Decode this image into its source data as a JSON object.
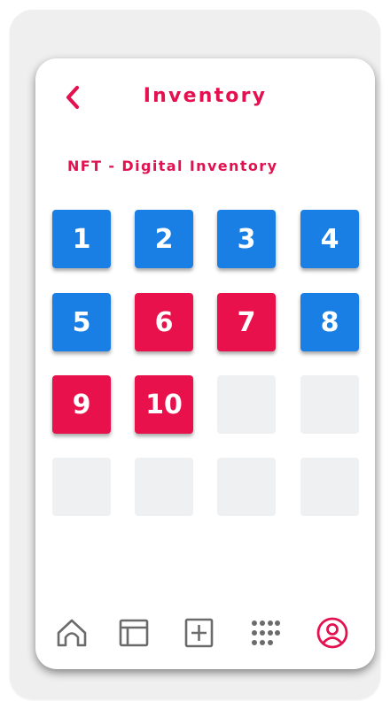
{
  "header": {
    "title": "Inventory",
    "back_icon": "chevron-left-icon"
  },
  "subtitle": "NFT - Digital Inventory",
  "colors": {
    "accent": "#e3114f",
    "tile_blue": "#1a7fe4",
    "tile_red": "#e8114c",
    "tile_empty": "#eef0f1",
    "icon_gray": "#6b6b6b"
  },
  "tiles": [
    {
      "label": "1",
      "color": "blue"
    },
    {
      "label": "2",
      "color": "blue"
    },
    {
      "label": "3",
      "color": "blue"
    },
    {
      "label": "4",
      "color": "blue"
    },
    {
      "label": "5",
      "color": "blue"
    },
    {
      "label": "6",
      "color": "red"
    },
    {
      "label": "7",
      "color": "red"
    },
    {
      "label": "8",
      "color": "blue"
    },
    {
      "label": "9",
      "color": "red"
    },
    {
      "label": "10",
      "color": "red"
    },
    {
      "label": "",
      "color": "empty"
    },
    {
      "label": "",
      "color": "empty"
    },
    {
      "label": "",
      "color": "empty"
    },
    {
      "label": "",
      "color": "empty"
    },
    {
      "label": "",
      "color": "empty"
    },
    {
      "label": "",
      "color": "empty"
    }
  ],
  "bottom_nav": [
    {
      "icon": "home-icon",
      "active": false
    },
    {
      "icon": "layout-icon",
      "active": false
    },
    {
      "icon": "add-square-icon",
      "active": false
    },
    {
      "icon": "apps-grid-icon",
      "active": false
    },
    {
      "icon": "user-profile-icon",
      "active": true
    }
  ]
}
